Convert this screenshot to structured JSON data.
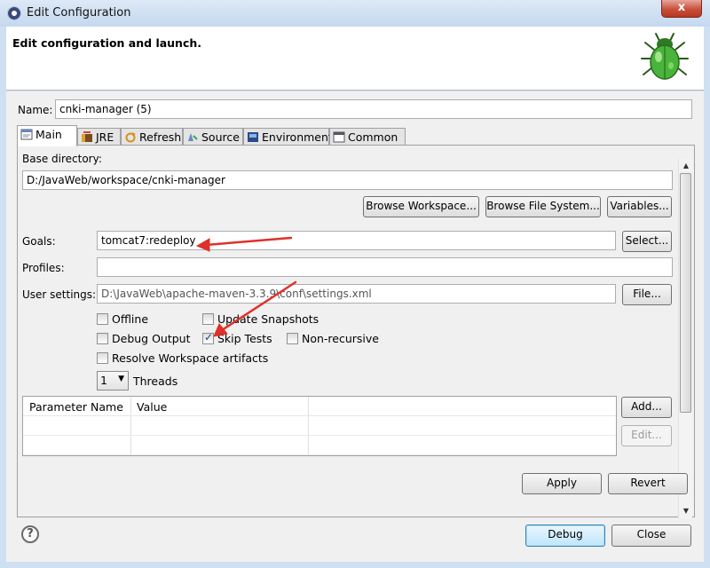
{
  "window": {
    "title": "Edit Configuration",
    "close_label": "x"
  },
  "header": {
    "title": "Edit configuration and launch."
  },
  "name_field": {
    "label": "Name:",
    "value": "cnki-manager (5)"
  },
  "tabs": [
    {
      "label": "Main",
      "icon": "main-tab-icon"
    },
    {
      "label": "JRE",
      "icon": "jre-icon"
    },
    {
      "label": "Refresh",
      "icon": "refresh-icon"
    },
    {
      "label": "Source",
      "icon": "source-icon"
    },
    {
      "label": "Environment",
      "icon": "environment-icon"
    },
    {
      "label": "Common",
      "icon": "common-icon"
    }
  ],
  "main": {
    "base_dir_label": "Base directory:",
    "base_dir_value": "D:/JavaWeb/workspace/cnki-manager",
    "browse_workspace": "Browse Workspace...",
    "browse_fs": "Browse File System...",
    "variables": "Variables...",
    "goals_label": "Goals:",
    "goals_value": "tomcat7:redeploy",
    "select_btn": "Select...",
    "profiles_label": "Profiles:",
    "profiles_value": "",
    "user_settings_label": "User settings:",
    "user_settings_value": "D:\\JavaWeb\\apache-maven-3.3.9\\conf\\settings.xml",
    "file_btn": "File...",
    "checkboxes": {
      "offline": {
        "label": "Offline",
        "checked": false
      },
      "update_snapshots": {
        "label": "Update Snapshots",
        "checked": false
      },
      "debug_output": {
        "label": "Debug Output",
        "checked": false
      },
      "skip_tests": {
        "label": "Skip Tests",
        "checked": true
      },
      "non_recursive": {
        "label": "Non-recursive",
        "checked": false
      },
      "resolve_workspace": {
        "label": "Resolve Workspace artifacts",
        "checked": false
      }
    },
    "threads_value": "1",
    "threads_label": "Threads",
    "param_table": {
      "columns": [
        "Parameter Name",
        "Value"
      ],
      "rows": []
    },
    "add_btn": "Add...",
    "edit_btn": "Edit..."
  },
  "apply_btn": "Apply",
  "revert_btn": "Revert",
  "debug_btn": "Debug",
  "close_btn": "Close",
  "colors": {
    "annotation_arrow": "#e0302a",
    "accent": "#3c7fb1"
  }
}
